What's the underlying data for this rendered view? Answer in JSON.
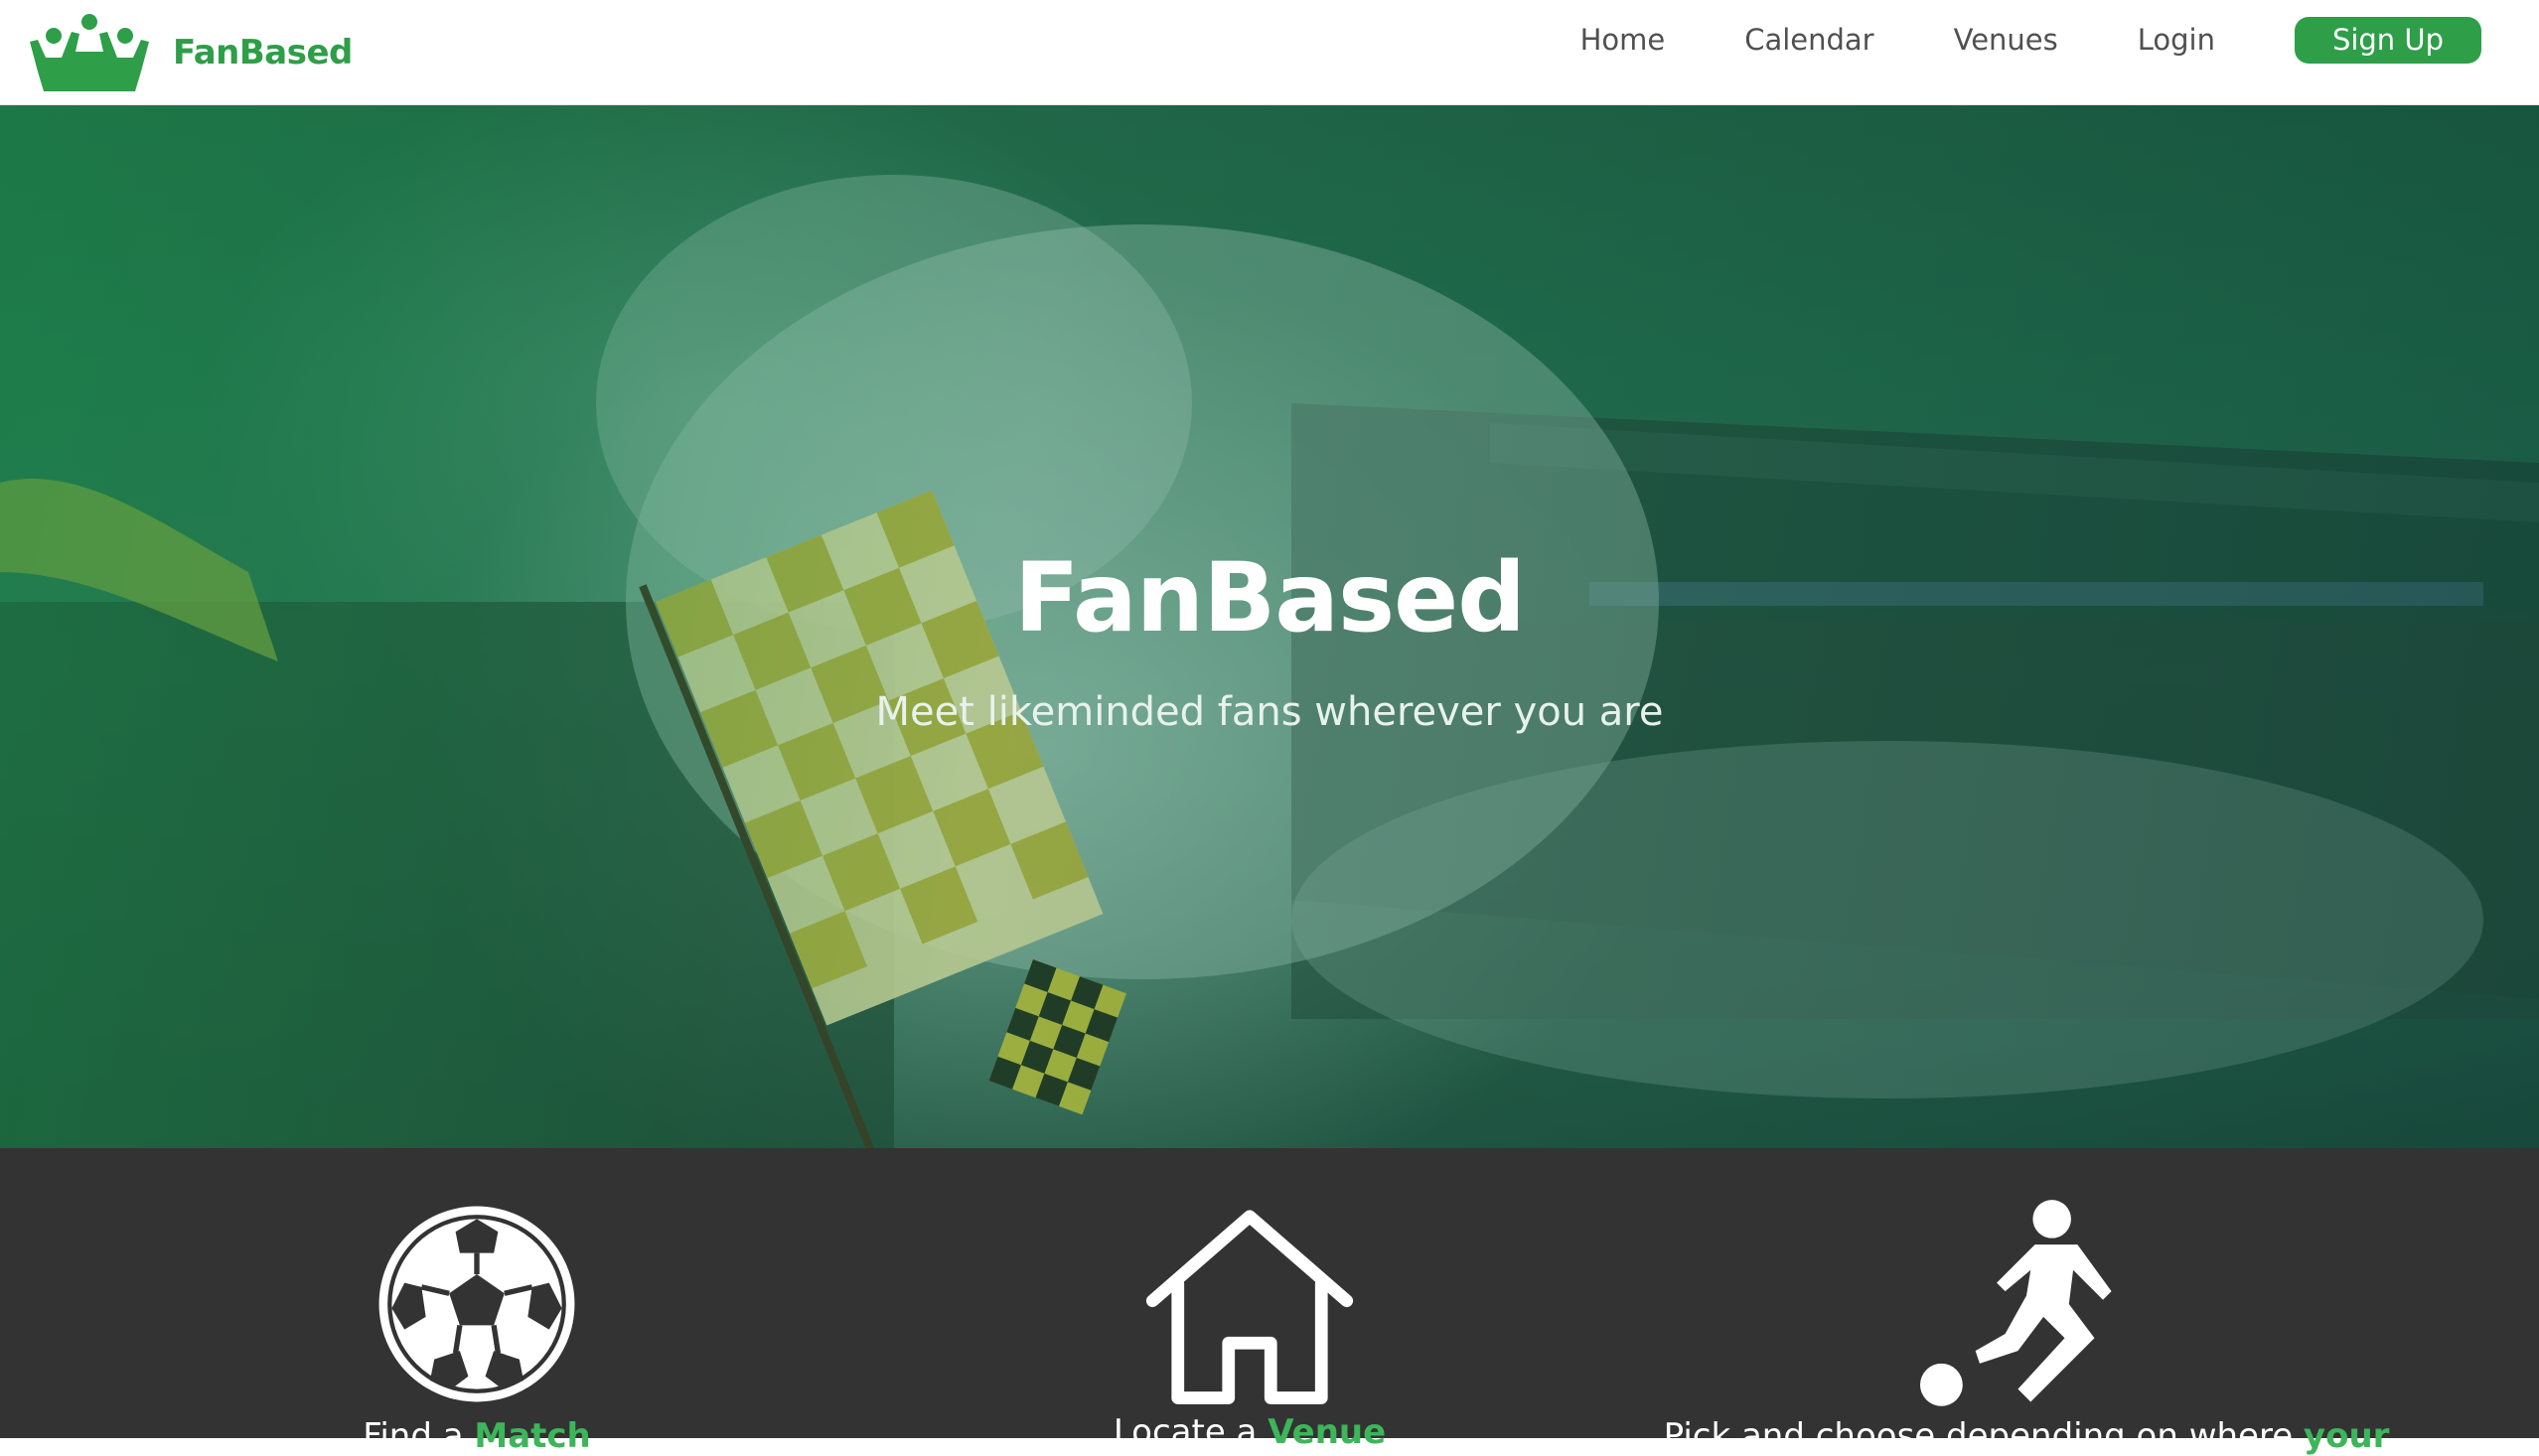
{
  "brand": {
    "name": "FanBased",
    "color": "#2e9e48"
  },
  "nav": {
    "links": [
      "Home",
      "Calendar",
      "Venues",
      "Login"
    ],
    "signup_label": "Sign Up"
  },
  "hero": {
    "title": "FanBased",
    "subtitle": "Meet likeminded fans wherever you are"
  },
  "features": [
    {
      "icon": "soccer-ball-icon",
      "prefix": "Find a ",
      "highlight": "Match"
    },
    {
      "icon": "house-icon",
      "prefix": "Locate a ",
      "highlight": "Venue"
    },
    {
      "icon": "soccer-player-icon",
      "prefix": "Pick and choose depending on where ",
      "highlight": "your"
    }
  ],
  "colors": {
    "accent": "#2e9e48",
    "highlight": "#3db55a",
    "footer_bg": "#333333"
  }
}
